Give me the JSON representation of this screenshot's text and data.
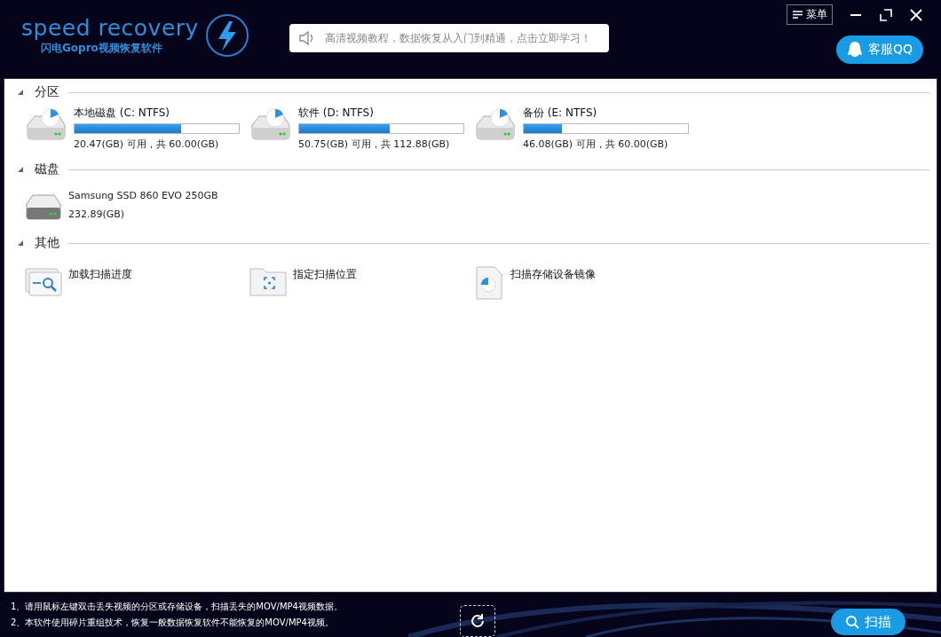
{
  "header": {
    "logo": "speed recovery",
    "subtitle": "闪电Gopro视频恢复软件",
    "notice": "高清视频教程，数据恢复从入门到精通，点击立即学习！",
    "menu": "菜单",
    "support": "客服QQ"
  },
  "sections": [
    {
      "title": "分区",
      "expanded": true,
      "kind": "partition",
      "items": [
        {
          "name": "本地磁盘 (C: NTFS)",
          "level": 0.65,
          "info": "20.47(GB) 可用，共 60.00(GB)"
        },
        {
          "name": "软件 (D: NTFS)",
          "level": 0.55,
          "info": "50.75(GB) 可用，共 112.88(GB)"
        },
        {
          "name": "备份 (E: NTFS)",
          "level": 0.23,
          "info": "46.08(GB) 可用，共 60.00(GB)"
        }
      ]
    },
    {
      "title": "磁盘",
      "expanded": true,
      "kind": "disk",
      "items": [
        {
          "name": "Samsung SSD 860 EVO 250GB",
          "info": "232.89(GB)"
        }
      ]
    },
    {
      "title": "其他",
      "expanded": true,
      "kind": "other",
      "items": [
        {
          "name": "加载扫描进度"
        },
        {
          "name": "指定扫描位置"
        },
        {
          "name": "扫描存储设备镜像"
        }
      ]
    }
  ],
  "footer": {
    "tips": [
      "1、请用鼠标左键双击丢失视频的分区或存储设备，扫描丢失的MOV/MP4视频数据。",
      "2、本软件使用碎片重组技术，恢复一般数据恢复软件不能恢复的MOV/MP4视频。"
    ],
    "scan": "扫描"
  }
}
